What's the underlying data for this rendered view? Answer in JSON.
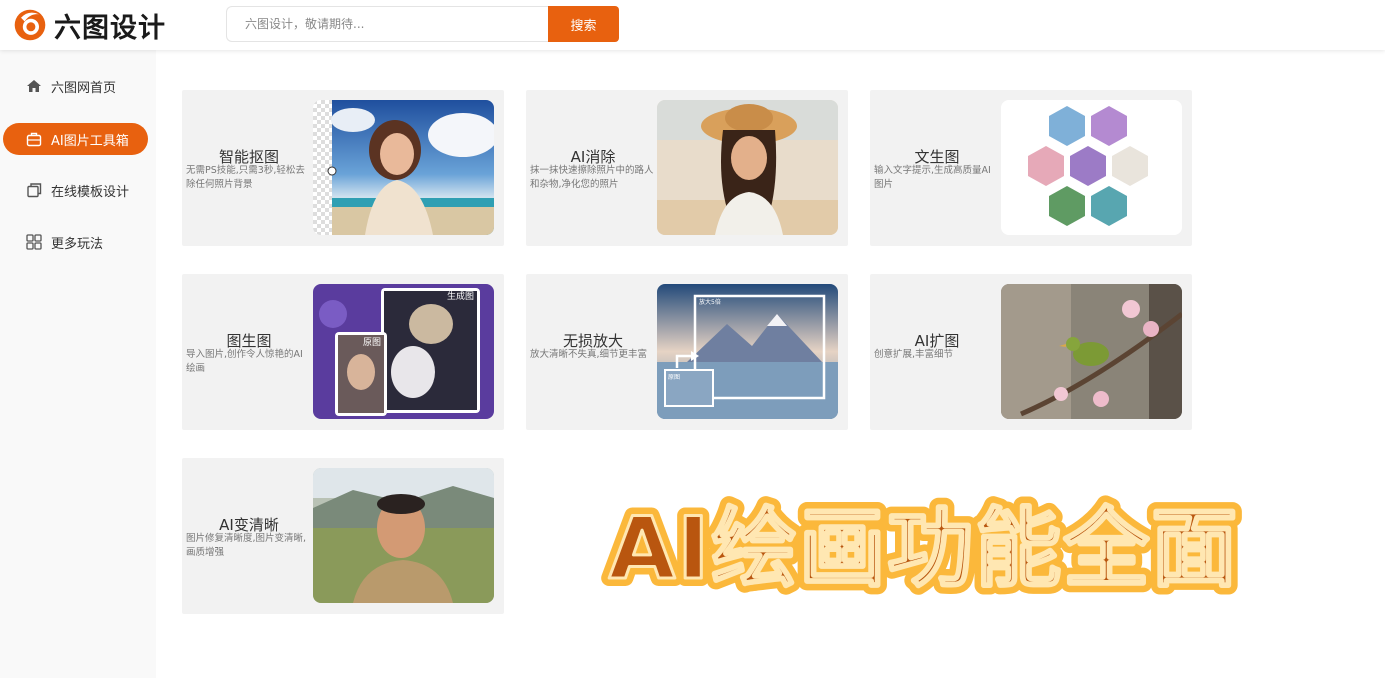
{
  "header": {
    "logo_text": "六图设计",
    "search_placeholder": "六图设计，敬请期待...",
    "search_button": "搜索"
  },
  "sidebar": {
    "items": [
      {
        "label": "六图网首页",
        "icon": "home-icon",
        "active": false
      },
      {
        "label": "AI图片工具箱",
        "icon": "toolbox-icon",
        "active": true
      },
      {
        "label": "在线模板设计",
        "icon": "template-icon",
        "active": false
      },
      {
        "label": "更多玩法",
        "icon": "grid-icon",
        "active": false
      }
    ]
  },
  "cards": [
    {
      "title": "智能抠图",
      "desc": "无需PS技能,只需3秒,轻松去除任何照片背景"
    },
    {
      "title": "AI消除",
      "desc": "抹一抹快速擦除照片中的路人和杂物,净化您的照片"
    },
    {
      "title": "文生图",
      "desc": "输入文字提示,生成高质量AI图片"
    },
    {
      "title": "图生图",
      "desc": "导入图片,创作令人惊艳的AI绘画",
      "image_labels": {
        "generated": "生成图",
        "original": "原图"
      }
    },
    {
      "title": "无损放大",
      "desc": "放大清晰不失真,细节更丰富",
      "image_labels": {
        "zoomed": "放大5倍",
        "original": "原图"
      }
    },
    {
      "title": "AI扩图",
      "desc": "创意扩展,丰富细节"
    },
    {
      "title": "AI变清晰",
      "desc": "图片修复清晰度,图片变清晰,画质增强"
    }
  ],
  "slogan": "AI绘画功能全面",
  "colors": {
    "accent": "#e8610f",
    "card_bg": "#f2f2f2",
    "slogan_fill": "#b9560f",
    "slogan_glow": "#f7a21b"
  }
}
